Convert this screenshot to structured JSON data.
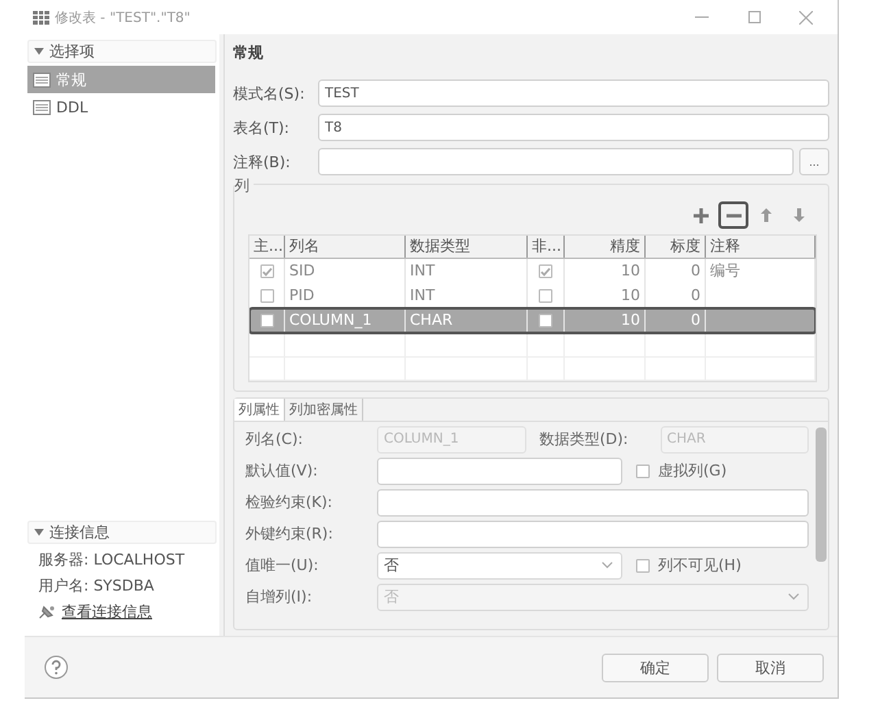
{
  "window": {
    "title": "修改表 - \"TEST\".\"T8\""
  },
  "sidebar": {
    "options_header": "选择项",
    "expanded": true,
    "items": [
      {
        "label": "常规",
        "selected": true
      },
      {
        "label": "DDL",
        "selected": false
      }
    ],
    "connection": {
      "header": "连接信息",
      "expanded": true,
      "server": "服务器: LOCALHOST",
      "user": "用户名: SYSDBA",
      "link": "查看连接信息"
    }
  },
  "main": {
    "heading": "常规",
    "fields": [
      {
        "label": "模式名(S):",
        "value": "TEST",
        "kind": "text"
      },
      {
        "label": "表名(T):",
        "value": "T8",
        "kind": "text"
      },
      {
        "label": "注释(B):",
        "kind": "browse",
        "button": "..."
      }
    ],
    "columns_group": {
      "title": "列",
      "toolbar": [
        {
          "kind": "add",
          "highlighted": false
        },
        {
          "kind": "remove",
          "highlighted": true
        },
        {
          "kind": "up",
          "highlighted": false
        },
        {
          "kind": "down",
          "highlighted": false
        }
      ],
      "table": {
        "columns": [
          "主...",
          "列名",
          "数据类型",
          "非...",
          "精度",
          "标度",
          "注释"
        ],
        "rows": [
          {
            "primary_key": true,
            "name": "SID",
            "type": "INT",
            "not_null": true,
            "precision": "10",
            "scale": "0",
            "comment": "编号",
            "selected": false,
            "highlighted": false
          },
          {
            "primary_key": false,
            "name": "PID",
            "type": "INT",
            "not_null": false,
            "precision": "10",
            "scale": "0",
            "selected": false,
            "highlighted": false
          },
          {
            "primary_key": false,
            "name": "COLUMN_1",
            "type": "CHAR",
            "not_null": false,
            "precision": "10",
            "scale": "0",
            "selected": true,
            "highlighted": true
          }
        ]
      }
    },
    "property_tabs": [
      {
        "label": "列属性",
        "selected": true
      },
      {
        "label": "列加密属性",
        "selected": false
      }
    ],
    "properties": [
      {
        "items": [
          {
            "kind": "label",
            "text": "列名(C):"
          },
          {
            "kind": "input",
            "value": "COLUMN_1",
            "disabled": true
          },
          {
            "kind": "label",
            "text": "数据类型(D):"
          },
          {
            "kind": "input",
            "value": "CHAR",
            "disabled": true
          }
        ]
      },
      {
        "items": [
          {
            "kind": "label",
            "text": "默认值(V):"
          },
          {
            "kind": "input",
            "disabled": false
          },
          {
            "kind": "checkbox",
            "text": "虚拟列(G)",
            "checked": false
          }
        ]
      },
      {
        "items": [
          {
            "kind": "label",
            "text": "检验约束(K):"
          },
          {
            "kind": "input",
            "disabled": false
          }
        ]
      },
      {
        "items": [
          {
            "kind": "label",
            "text": "外键约束(R):"
          },
          {
            "kind": "input",
            "disabled": false
          }
        ]
      },
      {
        "items": [
          {
            "kind": "label",
            "text": "值唯一(U):"
          },
          {
            "kind": "select",
            "value": "否",
            "disabled": false
          },
          {
            "kind": "checkbox",
            "text": "列不可见(H)",
            "checked": false
          }
        ]
      },
      {
        "items": [
          {
            "kind": "label",
            "text": "自增列(I):"
          },
          {
            "kind": "select",
            "value": "否",
            "disabled": true
          }
        ]
      }
    ]
  },
  "footer": {
    "buttons": [
      "确定",
      "取消"
    ]
  }
}
